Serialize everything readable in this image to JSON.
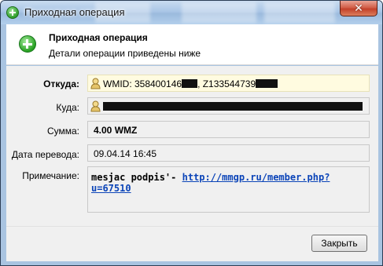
{
  "window": {
    "title": "Приходная операция",
    "close_glyph": "✕"
  },
  "header": {
    "title": "Приходная операция",
    "subtitle": "Детали операции приведены ниже",
    "icon": "green-plus-icon"
  },
  "fields": {
    "from": {
      "label": "Откуда:",
      "wmid_prefix": "WMID: 358400146",
      "purse": ", Z133544739",
      "icon": "webmoney-user-icon"
    },
    "to": {
      "label": "Куда:",
      "icon": "webmoney-user-icon"
    },
    "amount": {
      "label": "Сумма:",
      "value": "4.00 WMZ"
    },
    "date": {
      "label": "Дата перевода:",
      "value": "09.04.14 16:45"
    },
    "note": {
      "label": "Примечание:",
      "text": "mesjac podpis'- ",
      "link": "http://mmgp.ru/member.php?u=67510"
    }
  },
  "footer": {
    "close_label": "Закрыть"
  },
  "colors": {
    "highlight_bg": "#fffbe0",
    "link": "#0b44b8",
    "icon_green": "#27a021"
  }
}
